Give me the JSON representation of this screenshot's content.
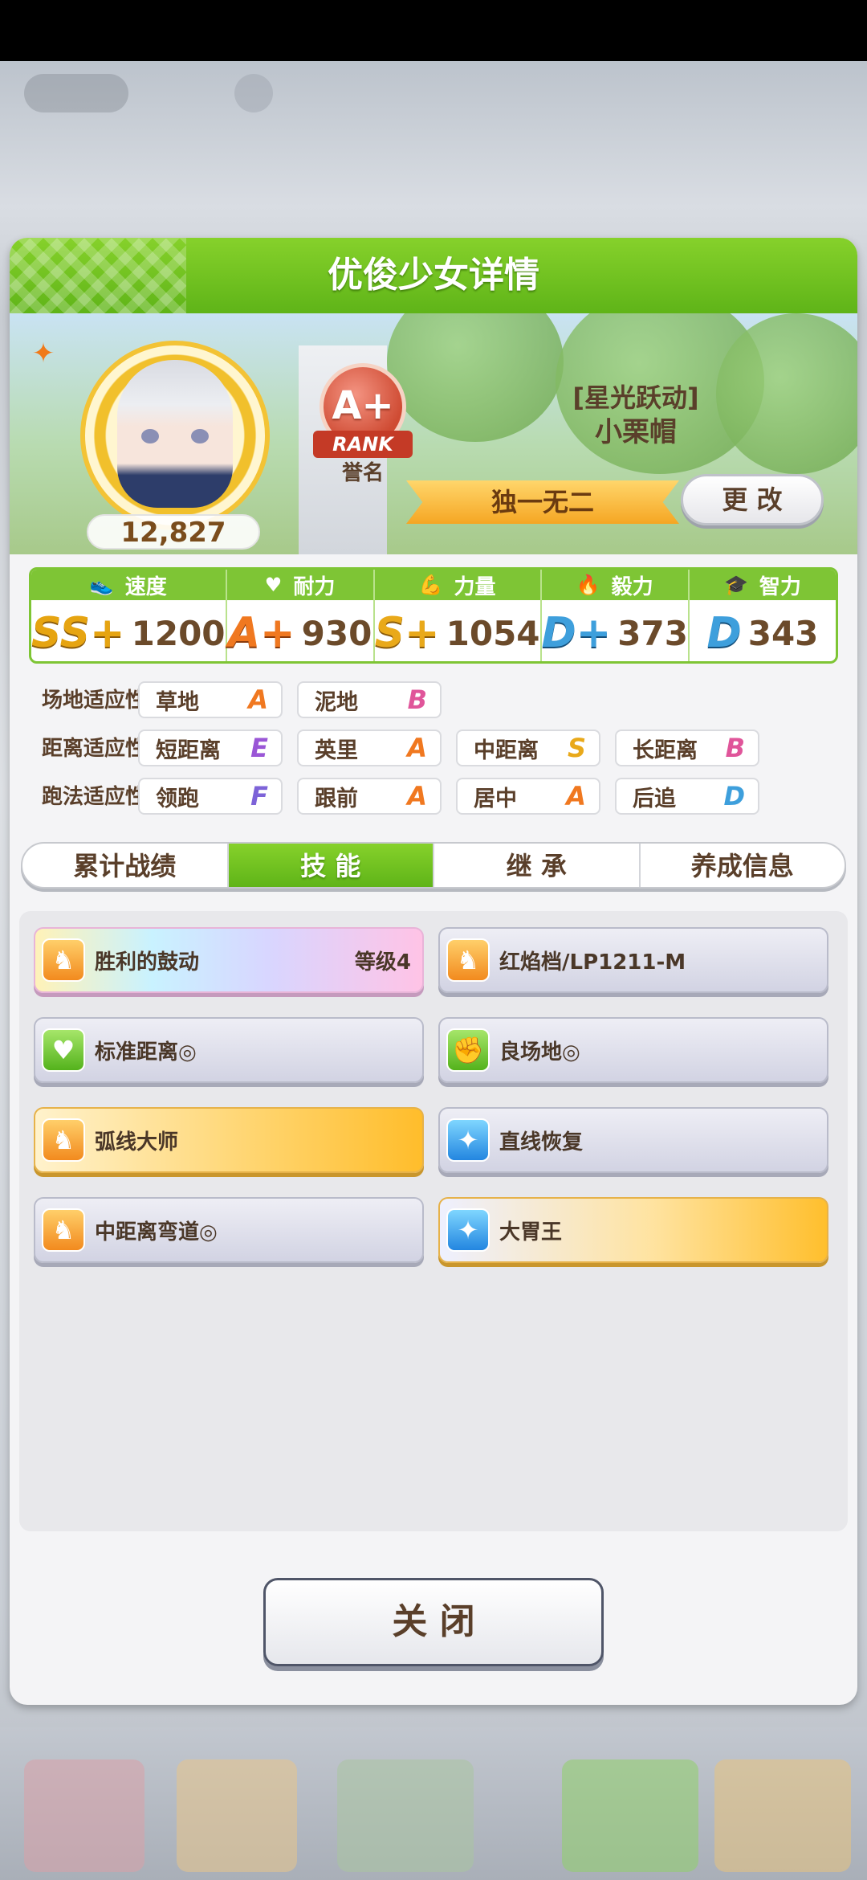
{
  "header": {
    "title": "优俊少女详情"
  },
  "profile": {
    "fans": "12,827",
    "rank": {
      "grade": "A+",
      "ribbon": "RANK",
      "label": "誉名"
    },
    "epithet": "[星光跃动]",
    "name": "小栗帽",
    "title_ribbon": "独一无二",
    "change_button": "更 改"
  },
  "stats": [
    {
      "label": "速度",
      "icon": "shoe-icon",
      "grade": "SS+",
      "value": "1200"
    },
    {
      "label": "耐力",
      "icon": "heart-icon",
      "grade": "A+",
      "value": "930"
    },
    {
      "label": "力量",
      "icon": "muscle-icon",
      "grade": "S+",
      "value": "1054"
    },
    {
      "label": "毅力",
      "icon": "flame-icon",
      "grade": "D+",
      "value": "373"
    },
    {
      "label": "智力",
      "icon": "graduation-cap-icon",
      "grade": "D",
      "value": "343"
    }
  ],
  "aptitude": {
    "field": {
      "label": "场地适应性",
      "items": [
        {
          "name": "草地",
          "grade": "A"
        },
        {
          "name": "泥地",
          "grade": "B"
        }
      ]
    },
    "distance": {
      "label": "距离适应性",
      "items": [
        {
          "name": "短距离",
          "grade": "E"
        },
        {
          "name": "英里",
          "grade": "A"
        },
        {
          "name": "中距离",
          "grade": "S"
        },
        {
          "name": "长距离",
          "grade": "B"
        }
      ]
    },
    "style": {
      "label": "跑法适应性",
      "items": [
        {
          "name": "领跑",
          "grade": "F"
        },
        {
          "name": "跟前",
          "grade": "A"
        },
        {
          "name": "居中",
          "grade": "A"
        },
        {
          "name": "后追",
          "grade": "D"
        }
      ]
    }
  },
  "tabs": [
    {
      "label": "累计战绩",
      "active": false
    },
    {
      "label": "技 能",
      "active": true
    },
    {
      "label": "继 承",
      "active": false
    },
    {
      "label": "养成信息",
      "active": false
    }
  ],
  "skills": [
    {
      "name": "胜利的鼓动",
      "level": "等级4",
      "icon": "horse-shoe-icon",
      "style": "rainbow"
    },
    {
      "name": "红焰档/LP1211-M",
      "level": "",
      "icon": "horse-shoe-icon",
      "style": "normal"
    },
    {
      "name": "标准距离◎",
      "level": "",
      "icon": "heart-icon",
      "style": "normal"
    },
    {
      "name": "良场地◎",
      "level": "",
      "icon": "muscle-icon",
      "style": "normal"
    },
    {
      "name": "弧线大师",
      "level": "",
      "icon": "horse-shoe-icon",
      "style": "gold"
    },
    {
      "name": "直线恢复",
      "level": "",
      "icon": "sparkle-icon",
      "style": "normal"
    },
    {
      "name": "中距离弯道◎",
      "level": "",
      "icon": "horse-shoe-icon",
      "style": "normal"
    },
    {
      "name": "大胃王",
      "level": "",
      "icon": "sparkle-icon",
      "style": "gold"
    }
  ],
  "close_button": "关 闭"
}
